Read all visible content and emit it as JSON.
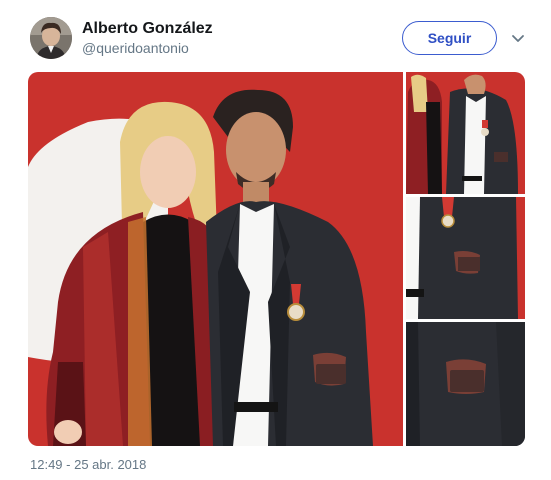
{
  "author": {
    "name": "Alberto González",
    "handle": "@queridoantonio"
  },
  "follow_button": {
    "label": "Seguir"
  },
  "icons": {
    "avatar": "profile-avatar",
    "caret": "chevron-down-icon"
  },
  "media": {
    "photo_count": 4
  },
  "timestamp": "12:49 - 25 abr. 2018",
  "colors": {
    "accent": "#3b5ccf",
    "backdrop_red": "#c8322c",
    "muted_text": "#657786"
  }
}
